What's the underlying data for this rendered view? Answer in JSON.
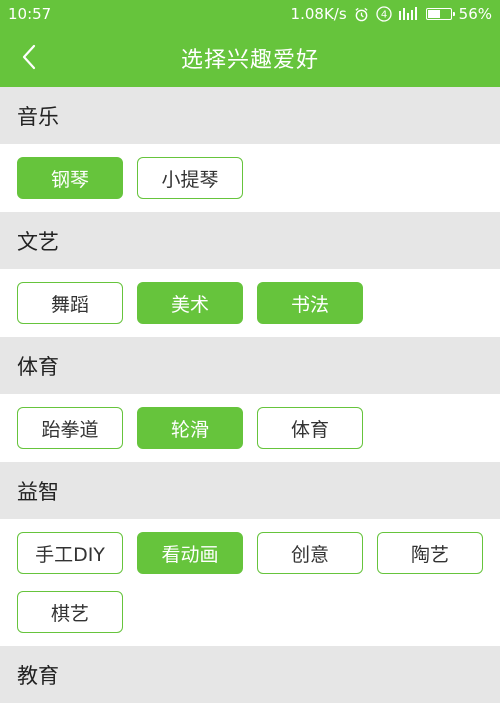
{
  "status_bar": {
    "time": "10:57",
    "speed": "1.08K/s",
    "alarm_icon": "alarm-clock-icon",
    "sim_badge": "4",
    "signal_icon": "signal-bars-icon",
    "battery_percent": "56%",
    "battery_level": 0.56
  },
  "header": {
    "title": "选择兴趣爱好",
    "back_icon": "chevron-left-icon"
  },
  "colors": {
    "accent": "#66c43c",
    "section_bg": "#e6e6e6",
    "tag_text": "#333333"
  },
  "sections": [
    {
      "title": "音乐",
      "tags": [
        {
          "label": "钢琴",
          "selected": true
        },
        {
          "label": "小提琴",
          "selected": false
        }
      ]
    },
    {
      "title": "文艺",
      "tags": [
        {
          "label": "舞蹈",
          "selected": false
        },
        {
          "label": "美术",
          "selected": true
        },
        {
          "label": "书法",
          "selected": true
        }
      ]
    },
    {
      "title": "体育",
      "tags": [
        {
          "label": "跆拳道",
          "selected": false
        },
        {
          "label": "轮滑",
          "selected": true
        },
        {
          "label": "体育",
          "selected": false
        }
      ]
    },
    {
      "title": "益智",
      "tags": [
        {
          "label": "手工DIY",
          "selected": false
        },
        {
          "label": "看动画",
          "selected": true
        },
        {
          "label": "创意",
          "selected": false
        },
        {
          "label": "陶艺",
          "selected": false
        },
        {
          "label": "棋艺",
          "selected": false
        }
      ]
    },
    {
      "title": "教育",
      "tags": []
    }
  ]
}
